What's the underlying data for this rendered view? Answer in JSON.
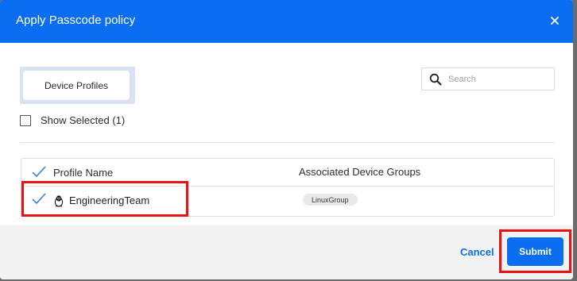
{
  "dialog": {
    "title": "Apply Passcode policy",
    "close_icon": "close-icon"
  },
  "tabs": {
    "active_label": "Device Profiles"
  },
  "search": {
    "placeholder": "Search",
    "value": "",
    "icon": "search-icon"
  },
  "filter": {
    "show_selected_label": "Show Selected (1)",
    "checked": false
  },
  "table": {
    "columns": [
      "Profile Name",
      "Associated Device Groups"
    ],
    "rows": [
      {
        "selected": true,
        "os_icon": "linux-penguin-icon",
        "profile_name": "EngineeringTeam",
        "group_tag": "LinuxGroup"
      }
    ]
  },
  "footer": {
    "cancel_label": "Cancel",
    "submit_label": "Submit"
  },
  "colors": {
    "primary": "#0b6ef0",
    "highlight": "#ee1111",
    "footer_bg": "#f2f2f2"
  }
}
